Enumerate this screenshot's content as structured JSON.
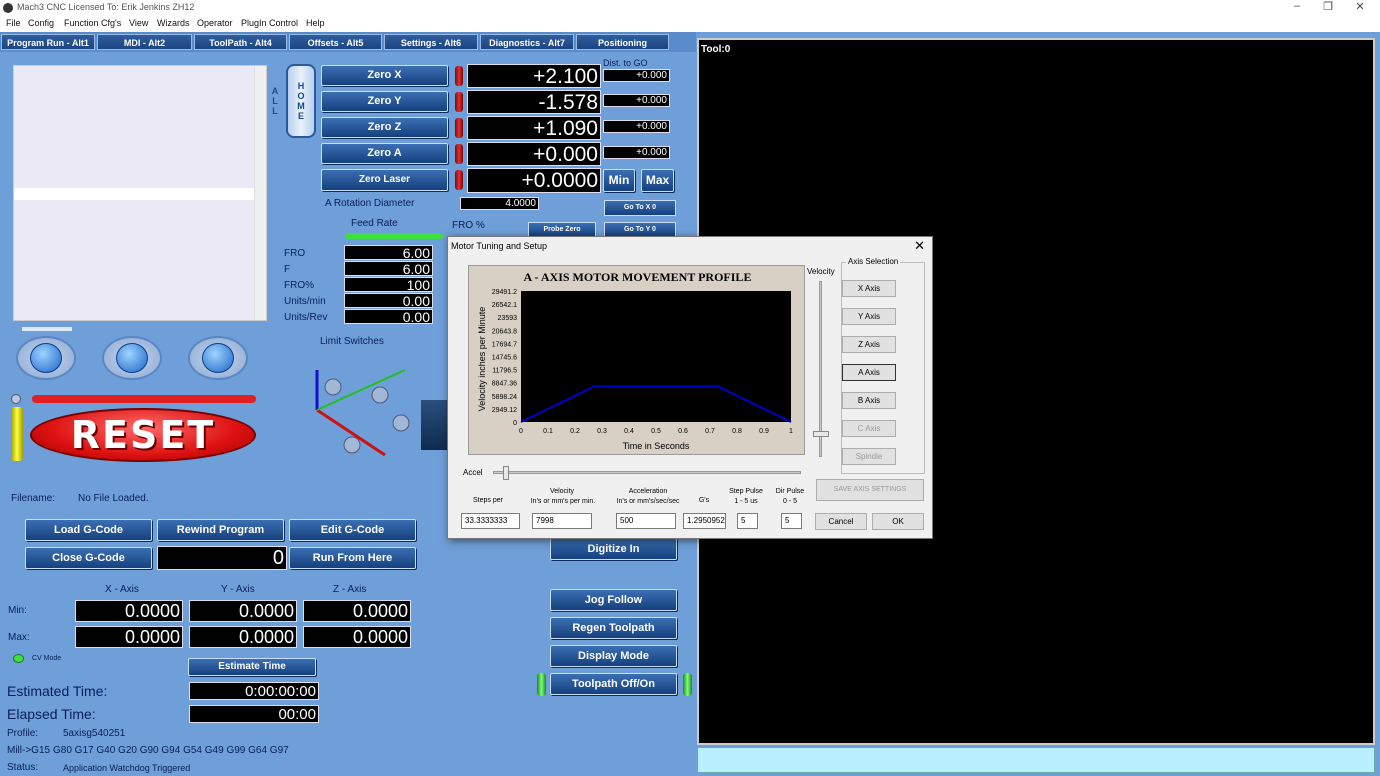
{
  "window": {
    "title": "Mach3 CNC  Licensed To: Erik Jenkins ZH12",
    "minimize": "–",
    "maximize": "❐",
    "close": "✕"
  },
  "menu": [
    "File",
    "Config",
    "Function Cfg's",
    "View",
    "Wizards",
    "Operator",
    "PlugIn Control",
    "Help"
  ],
  "tabs": [
    "Program Run - Alt1",
    "MDI - Alt2",
    "ToolPath - Alt4",
    "Offsets - Alt5",
    "Settings - Alt6",
    "Diagnostics - Alt7",
    "Positioning"
  ],
  "home_all": "HOME ALL",
  "axes": [
    {
      "zero_label": "Zero X",
      "value": "+2.100",
      "to_go": "+0.000"
    },
    {
      "zero_label": "Zero Y",
      "value": "-1.578",
      "to_go": "+0.000"
    },
    {
      "zero_label": "Zero Z",
      "value": "+1.090",
      "to_go": "+0.000"
    },
    {
      "zero_label": "Zero A",
      "value": "+0.000",
      "to_go": "+0.000"
    }
  ],
  "laser": {
    "zero_label": "Zero Laser",
    "value": "+0.0000",
    "min": "Min",
    "max": "Max"
  },
  "dist_to_go": "Dist. to GO",
  "rotation": {
    "label": "A Rotation Diameter",
    "value": "4.0000"
  },
  "goto": {
    "x": "Go To X 0",
    "y": "Go To Y 0",
    "probe": "Probe Zero"
  },
  "feed": {
    "title": "Feed Rate",
    "fro_pct_title": "FRO %",
    "rows": [
      {
        "label": "FRO",
        "value": "6.00"
      },
      {
        "label": "F",
        "value": "6.00"
      },
      {
        "label": "FRO%",
        "value": "100"
      },
      {
        "label": "Units/min",
        "value": "0.00"
      },
      {
        "label": "Units/Rev",
        "value": "0.00"
      }
    ]
  },
  "limit_switches": "Limit Switches",
  "reset": "RESET",
  "filename": {
    "label": "Filename:",
    "value": "No File Loaded."
  },
  "gbuttons": {
    "load": "Load G-Code",
    "rewind": "Rewind Program",
    "edit": "Edit G-Code",
    "close": "Close G-Code",
    "line": "0",
    "run_from": "Run From Here"
  },
  "extents": {
    "headers": [
      "X - Axis",
      "Y - Axis",
      "Z - Axis"
    ],
    "min_label": "Min:",
    "max_label": "Max:",
    "min": [
      "0.0000",
      "0.0000",
      "0.0000"
    ],
    "max": [
      "0.0000",
      "0.0000",
      "0.0000"
    ]
  },
  "cv_mode": "CV Mode",
  "estimate_btn": "Estimate Time",
  "estimated": {
    "label": "Estimated Time:",
    "value": "0:00:00:00"
  },
  "elapsed": {
    "label": "Elapsed Time:",
    "value": "00:00"
  },
  "profile": {
    "label": "Profile:",
    "value": "5axisg540251"
  },
  "modes": {
    "label": "Mill->G15",
    "value": "G80 G17 G40 G20 G90 G94 G54 G49 G99 G64 G97"
  },
  "status": {
    "label": "Status:",
    "value": "Application Watchdog Triggered"
  },
  "right_buttons": {
    "digitize": "Digitize In",
    "jog": "Jog Follow",
    "regen": "Regen Toolpath",
    "display": "Display Mode",
    "toolpath": "Toolpath Off/On"
  },
  "viewer": {
    "tool": "Tool:0"
  },
  "dialog": {
    "title": "Motor Tuning and Setup",
    "close": "✕",
    "velocity_label": "Velocity",
    "accel_label": "Accel",
    "axis_selection": "Axis Selection",
    "axis_buttons": [
      "X Axis",
      "Y Axis",
      "Z Axis",
      "A Axis",
      "B Axis",
      "C Axis",
      "Spindle"
    ],
    "save": "SAVE AXIS SETTINGS",
    "cancel": "Cancel",
    "ok": "OK",
    "fields": [
      {
        "label1": "Steps per",
        "label2": "",
        "value": "33.3333333"
      },
      {
        "label1": "Velocity",
        "label2": "In's or mm's per min.",
        "value": "7998"
      },
      {
        "label1": "Acceleration",
        "label2": "In's or mm's/sec/sec",
        "value": "500"
      },
      {
        "label1": "G's",
        "label2": "",
        "value": "1.2950952"
      },
      {
        "label1": "Step Pulse",
        "label2": "1 - 5 us",
        "value": "5"
      },
      {
        "label1": "Dir Pulse",
        "label2": "0 - 5",
        "value": "5"
      }
    ]
  },
  "chart_data": {
    "type": "line",
    "title": "A - AXIS MOTOR MOVEMENT PROFILE",
    "xlabel": "Time in Seconds",
    "ylabel": "Velocity inches per Minute",
    "xlim": [
      0,
      1
    ],
    "ylim": [
      0,
      29491.2
    ],
    "x_ticks": [
      "0",
      "0.1",
      "0.2",
      "0.3",
      "0.4",
      "0.5",
      "0.6",
      "0.7",
      "0.8",
      "0.9",
      "1"
    ],
    "y_ticks": [
      "0",
      "2949.12",
      "5898.24",
      "8847.36",
      "11796.5",
      "14745.6",
      "17694.7",
      "20643.8",
      "23593",
      "26542.1",
      "29491.2"
    ],
    "series": [
      {
        "color": "#0000cc",
        "x": [
          0,
          0.27,
          0.73,
          1
        ],
        "y": [
          0,
          7998,
          7998,
          0
        ]
      }
    ]
  }
}
